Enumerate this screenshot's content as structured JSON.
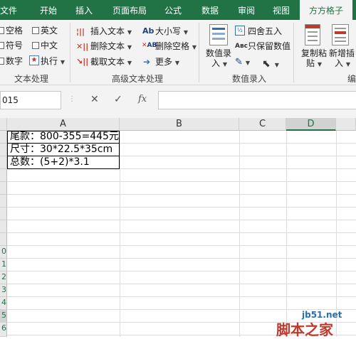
{
  "tabs": [
    "文件",
    "开始",
    "插入",
    "页面布局",
    "公式",
    "数据",
    "审阅",
    "视图",
    "方方格子"
  ],
  "ribbon": {
    "text_proc": {
      "checks": [
        "空格",
        "英文",
        "符号",
        "中文",
        "数字"
      ],
      "exec": "执行",
      "group": "文本处理"
    },
    "advanced": {
      "items": [
        "插入文本",
        "删除文本",
        "截取文本"
      ],
      "items2": [
        "大小写",
        "删除空格",
        "更多"
      ],
      "group": "高级文本处理"
    },
    "numeric": {
      "big": [
        "数值录",
        "入"
      ],
      "items": [
        "四舍五入",
        "只保留数值"
      ],
      "group": "数值录入"
    },
    "right": {
      "copy_paste": [
        "复制粘",
        "贴"
      ],
      "new_add": [
        "新增插",
        "入"
      ],
      "group_partial": "编"
    }
  },
  "formula_bar": {
    "name_box": "015",
    "cancel": "✕",
    "enter": "✓",
    "fx": "fx",
    "formula": ""
  },
  "columns": [
    "A",
    "B",
    "C",
    "D"
  ],
  "rows": [
    "",
    "",
    "",
    "",
    "",
    "",
    "",
    "",
    "",
    "0",
    "1",
    "2",
    "3",
    "4",
    "5",
    "6"
  ],
  "cells": [
    "尾款：800-355=445元",
    "尺寸：30*22.5*35cm",
    "总数：(5+2)*3.1"
  ],
  "watermark": {
    "site": "jb51.net",
    "name": "脚本之家"
  }
}
